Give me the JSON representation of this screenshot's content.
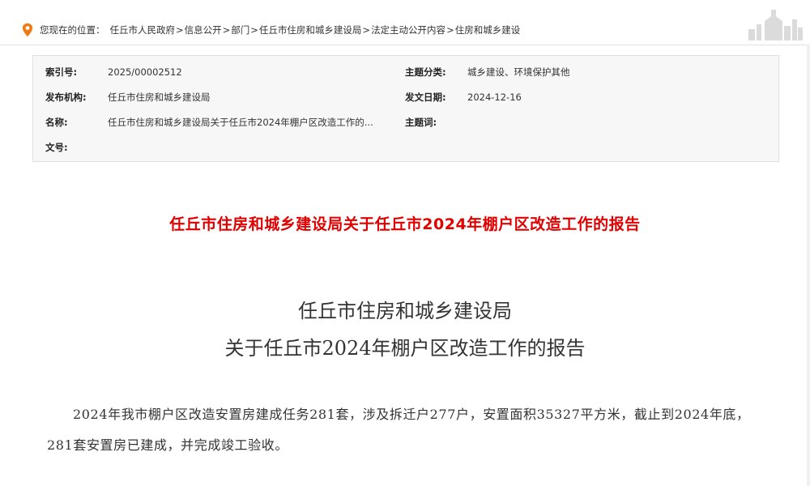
{
  "breadcrumb": {
    "prefix": "您现在的位置：",
    "items": [
      "任丘市人民政府",
      "信息公开",
      "部门",
      "任丘市住房和城乡建设局",
      "法定主动公开内容",
      "住房和城乡建设"
    ],
    "separator": ">"
  },
  "meta": {
    "index_label": "索引号:",
    "index_value": "2025/00002512",
    "topic_label": "主题分类:",
    "topic_value": "城乡建设、环境保护其他",
    "issuer_label": "发布机构:",
    "issuer_value": "任丘市住房和城乡建设局",
    "date_label": "发文日期:",
    "date_value": "2024-12-16",
    "name_label": "名称:",
    "name_value": "任丘市住房和城乡建设局关于任丘市2024年棚户区改造工作的...",
    "keyword_label": "主题词:",
    "keyword_value": "",
    "docno_label": "文号:",
    "docno_value": ""
  },
  "article": {
    "red_title": "任丘市住房和城乡建设局关于任丘市2024年棚户区改造工作的报告",
    "title_line1": "任丘市住房和城乡建设局",
    "title_line2": "关于任丘市2024年棚户区改造工作的报告",
    "paragraph1": "2024年我市棚户区改造安置房建成任务281套，涉及拆迁户277户，安置面积35327平方米，截止到2024年底，281套安置房已建成，并完成竣工验收。"
  },
  "colors": {
    "accent_red": "#e00000",
    "pin_orange": "#f07a14",
    "meta_bg": "#f7f7f7"
  },
  "icons": {
    "location": "location-pin-icon",
    "skyline": "city-skyline-icon"
  }
}
